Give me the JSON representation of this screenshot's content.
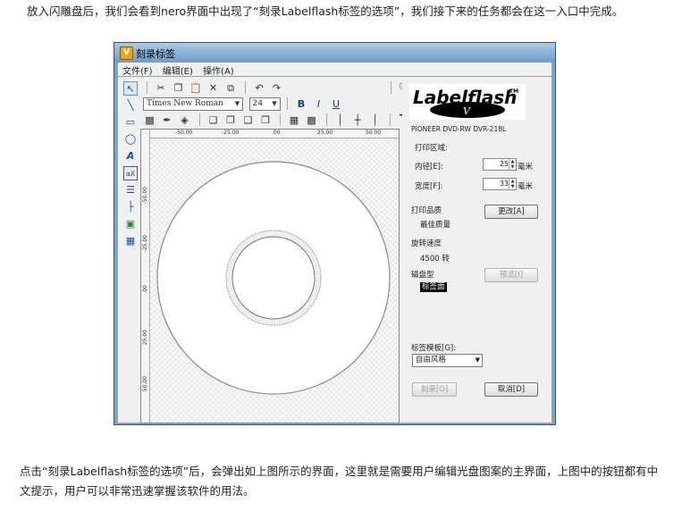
{
  "article": {
    "top_paragraph": "放入闪雕盘后，我们会看到nero界面中出现了“刻录Labelflash标签的选项”，我们接下来的任务都会在这一入口中完成。",
    "bottom_paragraph": "点击“刻录Labelflash标签的选项”后，会弹出如上图所示的界面，这里就是需要用户编辑光盘图案的主界面，上图中的按钮都有中文提示，用户可以非常迅速掌握该软件的用法。"
  },
  "window": {
    "title": "刻录标签",
    "title_icon": "V",
    "menu": [
      "文件(F)",
      "编辑(E)",
      "操作(A)"
    ]
  },
  "toolbar": {
    "font_name": "Times New Roman",
    "font_size": "24",
    "bold": "B",
    "italic": "I",
    "underline": "U"
  },
  "left_tools": [
    "select-tool-icon",
    "line-tool-icon",
    "rectangle-tool-icon",
    "ellipse-tool-icon",
    "text-tool-icon",
    "text-frame-icon",
    "list-icon",
    "tree-icon",
    "image-icon",
    "frame-icon"
  ],
  "ruler": {
    "top_labels": [
      "-50.00",
      "-25.00",
      ".00",
      "25.00",
      "50.00"
    ],
    "left_labels": [
      "-50.00",
      "-25.00",
      ".00",
      "25.00",
      "50.00"
    ]
  },
  "panel": {
    "logo_text": "Labelflash",
    "logo_tm": "TM",
    "logo_v": "V",
    "drive_name": "PIONEER DVD-RW  DVR-218L",
    "print_area_label": "打印区域:",
    "inner_diameter_label": "内径[E]:",
    "inner_diameter_value": "25",
    "inner_diameter_unit": "毫米",
    "width_label": "宽度[F]:",
    "width_value": "33",
    "width_unit": "毫米",
    "print_quality_label": "打印品质",
    "print_quality_value": "最佳质量",
    "change_button": "更改[A]",
    "rotation_speed_label": "旋转速度",
    "rotation_speed_value": "4500 转",
    "disc_type_label": "磁盘型",
    "disc_type_value": "标签面",
    "preview_button": "预览[I]",
    "template_label": "标签模板[G]:",
    "template_value": "自由风格",
    "burn_button": "刻录[O]",
    "cancel_button": "取消[D]"
  }
}
